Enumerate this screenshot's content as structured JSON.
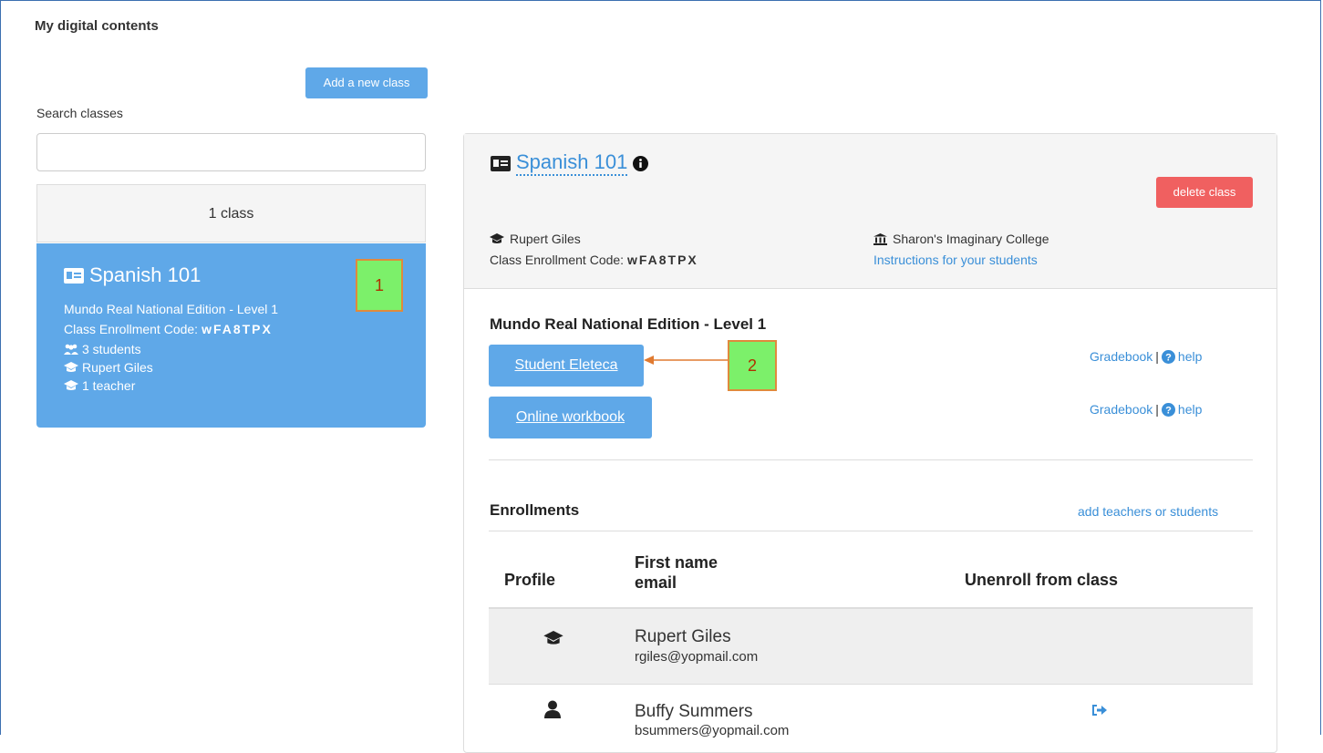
{
  "page": {
    "title": "My digital contents"
  },
  "sidebar": {
    "add_class_label": "Add a new class",
    "search_label": "Search classes",
    "search_value": "",
    "class_count": "1 class",
    "card": {
      "title": "Spanish 101",
      "edition": "Mundo Real National Edition - Level 1",
      "code_label": "Class Enrollment Code:",
      "code": "wFA8TPX",
      "students": "3 students",
      "teacher_name": "Rupert Giles",
      "teachers": "1 teacher"
    }
  },
  "annotations": {
    "one": "1",
    "two": "2"
  },
  "detail": {
    "title": "Spanish 101",
    "delete_label": "delete class",
    "teacher": "Rupert Giles",
    "code_label": "Class Enrollment Code:",
    "code": "wFA8TPX",
    "school": "Sharon's Imaginary College",
    "instructions_link": "Instructions for your students",
    "program_title": "Mundo Real National Edition - Level 1",
    "resources": [
      {
        "label": "Student Eleteca",
        "gradebook": "Gradebook",
        "sep": "|",
        "help": "help"
      },
      {
        "label": "Online workbook",
        "gradebook": "Gradebook",
        "sep": "|",
        "help": "help"
      }
    ],
    "enrollments_title": "Enrollments",
    "add_link": "add teachers or students",
    "table": {
      "col_profile": "Profile",
      "col_name_line1": "First name",
      "col_name_line2": "email",
      "col_unenroll": "Unenroll from class",
      "rows": [
        {
          "name": "Rupert Giles",
          "email": "rgiles@yopmail.com",
          "role_icon": "graduation-cap-icon"
        },
        {
          "name": "Buffy Summers",
          "email": "bsummers@yopmail.com",
          "role_icon": "user-icon"
        }
      ]
    }
  },
  "colors": {
    "accent": "#5fa8e8",
    "danger": "#f06060",
    "link": "#3a8fd8",
    "callout": "#7cf06a"
  }
}
